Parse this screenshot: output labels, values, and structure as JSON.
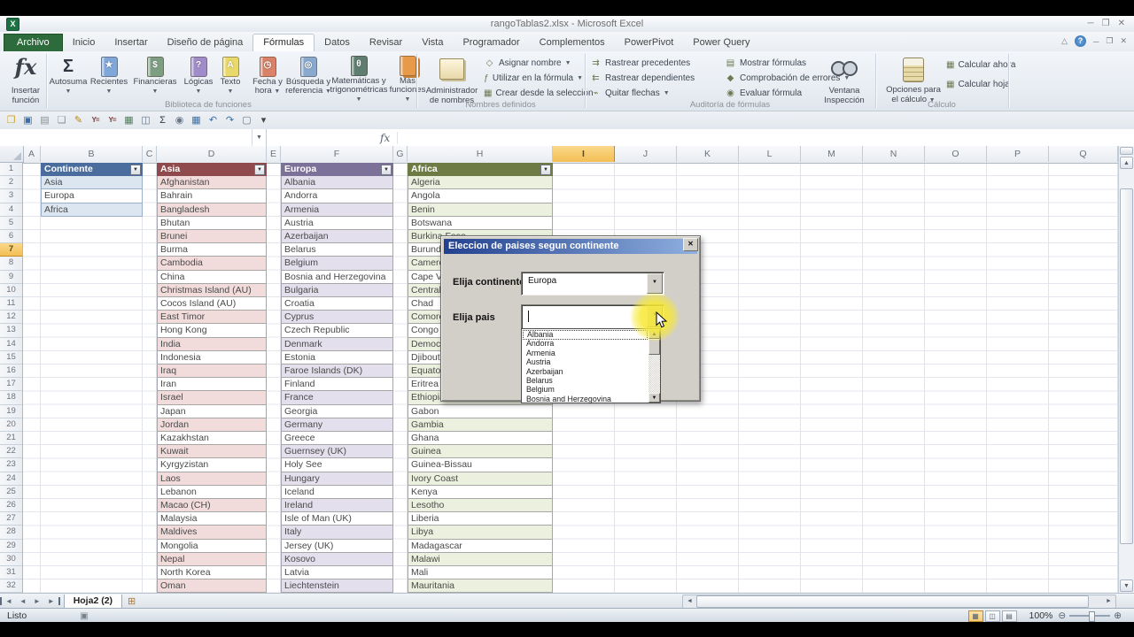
{
  "window": {
    "title": "rangoTablas2.xlsx - Microsoft Excel",
    "controls": [
      "─",
      "❐",
      "✕"
    ]
  },
  "tabs": {
    "items": [
      "Archivo",
      "Inicio",
      "Insertar",
      "Diseño de página",
      "Fórmulas",
      "Datos",
      "Revisar",
      "Vista",
      "Programador",
      "Complementos",
      "PowerPivot",
      "Power Query"
    ],
    "active": "Fórmulas"
  },
  "ribbon": {
    "group_labels": [
      "Biblioteca de funciones",
      "Nombres definidos",
      "Auditoría de fórmulas",
      "Cálculo"
    ],
    "insert_function_label": "Insertar función",
    "insert_function_glyph": "fx",
    "library": [
      {
        "label": "Autosuma",
        "glyph": "Σ",
        "color": "",
        "arrow": true
      },
      {
        "label": "Recientes",
        "glyph": "★",
        "color": "#7fa7d9",
        "arrow": true
      },
      {
        "label": "Financieras",
        "glyph": "$",
        "color": "#7e9e84",
        "arrow": true
      },
      {
        "label": "Lógicas",
        "glyph": "?",
        "color": "#a08cc8",
        "arrow": true
      },
      {
        "label": "Texto",
        "glyph": "A",
        "color": "#e9d96a",
        "arrow": true
      },
      {
        "label": "Fecha y hora",
        "glyph": "◷",
        "color": "#d98268",
        "arrow": true
      },
      {
        "label": "Búsqueda y referencia",
        "glyph": "◎",
        "color": "#89a9cf",
        "arrow": true
      },
      {
        "label": "Matemáticas y trigonométricas",
        "glyph": "θ",
        "color": "#5f7e72",
        "arrow": true
      },
      {
        "label": "Más funciones",
        "glyph": "",
        "color": "#e89a4b",
        "arrow": true
      }
    ],
    "names_group": {
      "big_label": "Administrador de nombres",
      "items": [
        {
          "label": "Asignar nombre",
          "glyph": "◇",
          "arrow": true
        },
        {
          "label": "Utilizar en la fórmula",
          "glyph": "ƒ",
          "arrow": true
        },
        {
          "label": "Crear desde la selección",
          "glyph": "▦",
          "arrow": false
        }
      ]
    },
    "audit_group": {
      "col1": [
        {
          "label": "Rastrear precedentes",
          "glyph": "⇉",
          "arrow": false
        },
        {
          "label": "Rastrear dependientes",
          "glyph": "⇇",
          "arrow": false
        },
        {
          "label": "Quitar flechas",
          "glyph": "⌁",
          "arrow": true
        }
      ],
      "col2": [
        {
          "label": "Mostrar fórmulas",
          "glyph": "▤",
          "arrow": false
        },
        {
          "label": "Comprobación de errores",
          "glyph": "◆",
          "arrow": true
        },
        {
          "label": "Evaluar fórmula",
          "glyph": "◉",
          "arrow": false
        }
      ]
    },
    "calc_group": {
      "watch_label": "Ventana Inspección",
      "options_label": "Opciones para el cálculo",
      "buttons": [
        {
          "label": "Calcular ahora",
          "glyph": "▦"
        },
        {
          "label": "Calcular hoja",
          "glyph": "▦"
        }
      ]
    }
  },
  "qat": [
    {
      "name": "open-file-icon",
      "glyph": "❐",
      "color": "#c9a227"
    },
    {
      "name": "save-icon",
      "glyph": "▣",
      "color": "#3a6ea5"
    },
    {
      "name": "permissions-icon",
      "glyph": "▤",
      "color": "#8a8f98"
    },
    {
      "name": "new-document-icon",
      "glyph": "❏",
      "color": "#8a8f98"
    },
    {
      "name": "format-painter-icon",
      "glyph": "✎",
      "color": "#b8860b"
    },
    {
      "name": "autofilter-icon",
      "glyph": "Y=",
      "color": "#7a3b3b"
    },
    {
      "name": "reapply-filter-icon",
      "glyph": "Y=",
      "color": "#7a3b3b"
    },
    {
      "name": "insert-picture-icon",
      "glyph": "▦",
      "color": "#4e7d5b"
    },
    {
      "name": "page-setup-icon",
      "glyph": "◫",
      "color": "#6a7687"
    },
    {
      "name": "autosum-icon",
      "glyph": "Σ",
      "color": "#2f3a4a"
    },
    {
      "name": "print-preview-icon",
      "glyph": "◉",
      "color": "#6a7687"
    },
    {
      "name": "insert-table-icon",
      "glyph": "▦",
      "color": "#3a6ea5"
    },
    {
      "name": "undo-icon",
      "glyph": "↶",
      "color": "#3a6ea5"
    },
    {
      "name": "redo-icon",
      "glyph": "↷",
      "color": "#3a6ea5"
    },
    {
      "name": "form-icon",
      "glyph": "▢",
      "color": "#6a7687"
    },
    {
      "name": "qat-menu-icon",
      "glyph": "▾",
      "color": "#444"
    }
  ],
  "formula_bar": {
    "name_box": "",
    "fx": "fx",
    "formula": ""
  },
  "sheet": {
    "columns": [
      "A",
      "B",
      "C",
      "D",
      "E",
      "F",
      "G",
      "H",
      "I",
      "J",
      "K",
      "L",
      "M",
      "N",
      "O",
      "P",
      "Q"
    ],
    "selected_column": "I",
    "selected_row": 7,
    "row_count": 32,
    "tables": [
      {
        "col": "B",
        "header": "Continente",
        "header_color": "#4a6d9e",
        "band_color": "#dce6f1",
        "border_color": "#9aaecb",
        "items": [
          "Asia",
          "Europa",
          "Africa"
        ]
      },
      {
        "col": "D",
        "header": "Asia",
        "header_color": "#8e4a4c",
        "band_color": "#f2dcdb",
        "border_color": "#a6a6a6",
        "items": [
          "Afghanistan",
          "Bahrain",
          "Bangladesh",
          "Bhutan",
          "Brunei",
          "Burma",
          "Cambodia",
          "China",
          "Christmas Island (AU)",
          "Cocos Island (AU)",
          "East Timor",
          "Hong Kong",
          "India",
          "Indonesia",
          "Iraq",
          "Iran",
          "Israel",
          "Japan",
          "Jordan",
          "Kazakhstan",
          "Kuwait",
          "Kyrgyzistan",
          "Laos",
          "Lebanon",
          "Macao (CH)",
          "Malaysia",
          "Maldives",
          "Mongolia",
          "Nepal",
          "North Korea",
          "Oman"
        ]
      },
      {
        "col": "F",
        "header": "Europa",
        "header_color": "#7c7199",
        "band_color": "#e4dfec",
        "border_color": "#a6a6a6",
        "items": [
          "Albania",
          "Andorra",
          "Armenia",
          "Austria",
          "Azerbaijan",
          "Belarus",
          "Belgium",
          "Bosnia and Herzegovina",
          "Bulgaria",
          "Croatia",
          "Cyprus",
          "Czech Republic",
          "Denmark",
          "Estonia",
          "Faroe Islands (DK)",
          "Finland",
          "France",
          "Georgia",
          "Germany",
          "Greece",
          "Guernsey (UK)",
          "Holy See",
          "Hungary",
          "Iceland",
          "Ireland",
          "Isle of Man (UK)",
          "Italy",
          "Jersey (UK)",
          "Kosovo",
          "Latvia",
          "Liechtenstein"
        ]
      },
      {
        "col": "H",
        "header": "Africa",
        "header_color": "#6f7b44",
        "band_color": "#ebf1de",
        "border_color": "#a6a6a6",
        "items": [
          "Algeria",
          "Angola",
          "Benin",
          "Botswana",
          "Burkina Faso",
          "Burundi",
          "Cameroon",
          "Cape Verde",
          "Central African Republic",
          "Chad",
          "Comoros",
          "Congo",
          "Democratic Republic of Congo",
          "Djibouti",
          "Equatorial Guinea",
          "Eritrea",
          "Ethiopia",
          "Gabon",
          "Gambia",
          "Ghana",
          "Guinea",
          "Guinea-Bissau",
          "Ivory Coast",
          "Kenya",
          "Lesotho",
          "Liberia",
          "Libya",
          "Madagascar",
          "Malawi",
          "Mali",
          "Mauritania"
        ]
      }
    ]
  },
  "dialog": {
    "title": "Eleccion de paises segun continente",
    "close_glyph": "✕",
    "fields": [
      {
        "label": "Elija continente",
        "value": "Europa"
      },
      {
        "label": "Elija pais",
        "value": ""
      }
    ],
    "dropdown_items": [
      "Albania",
      "Andorra",
      "Armenia",
      "Austria",
      "Azerbaijan",
      "Belarus",
      "Belgium",
      "Bosnia and Herzegovina"
    ],
    "focused_item": "Albania"
  },
  "sheet_tabs": {
    "active": "Hoja2 (2)",
    "nav": [
      "◄",
      "◄",
      "►",
      "►"
    ]
  },
  "status": {
    "mode": "Listo",
    "zoom": "100%"
  }
}
